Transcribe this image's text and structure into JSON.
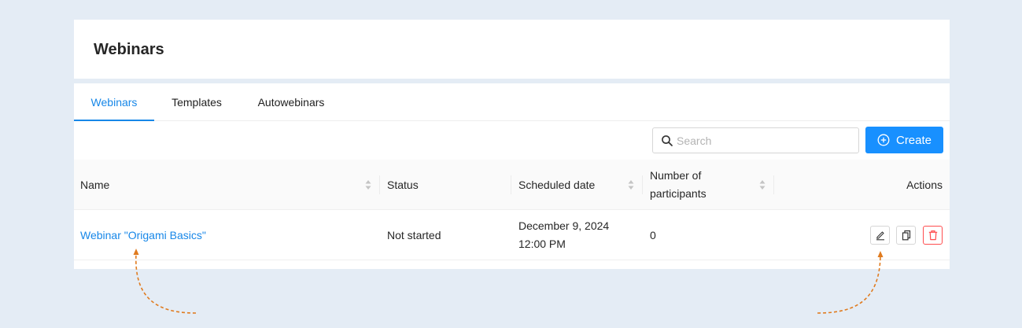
{
  "header": {
    "title": "Webinars"
  },
  "tabs": [
    {
      "label": "Webinars",
      "active": true
    },
    {
      "label": "Templates",
      "active": false
    },
    {
      "label": "Autowebinars",
      "active": false
    }
  ],
  "toolbar": {
    "search_placeholder": "Search",
    "search_value": "",
    "create_label": "Create"
  },
  "table": {
    "columns": {
      "name": "Name",
      "status": "Status",
      "scheduled_date": "Scheduled date",
      "participants_line1": "Number of",
      "participants_line2": "participants",
      "actions": "Actions"
    },
    "rows": [
      {
        "name": "Webinar \"Origami Basics\"",
        "status": "Not started",
        "date_line1": "December 9, 2024",
        "date_line2": "12:00 PM",
        "participants": "0"
      }
    ]
  },
  "colors": {
    "accent": "#1890ff",
    "link": "#1787e8",
    "danger": "#ff4d4f",
    "annotation_arrow": "#e07b1f",
    "background": "#e4ecf5"
  },
  "icons": {
    "search": "search-icon",
    "create": "plus-circle-icon",
    "sort": "sort-icon",
    "edit": "edit-icon",
    "copy": "copy-icon",
    "delete": "trash-icon"
  }
}
